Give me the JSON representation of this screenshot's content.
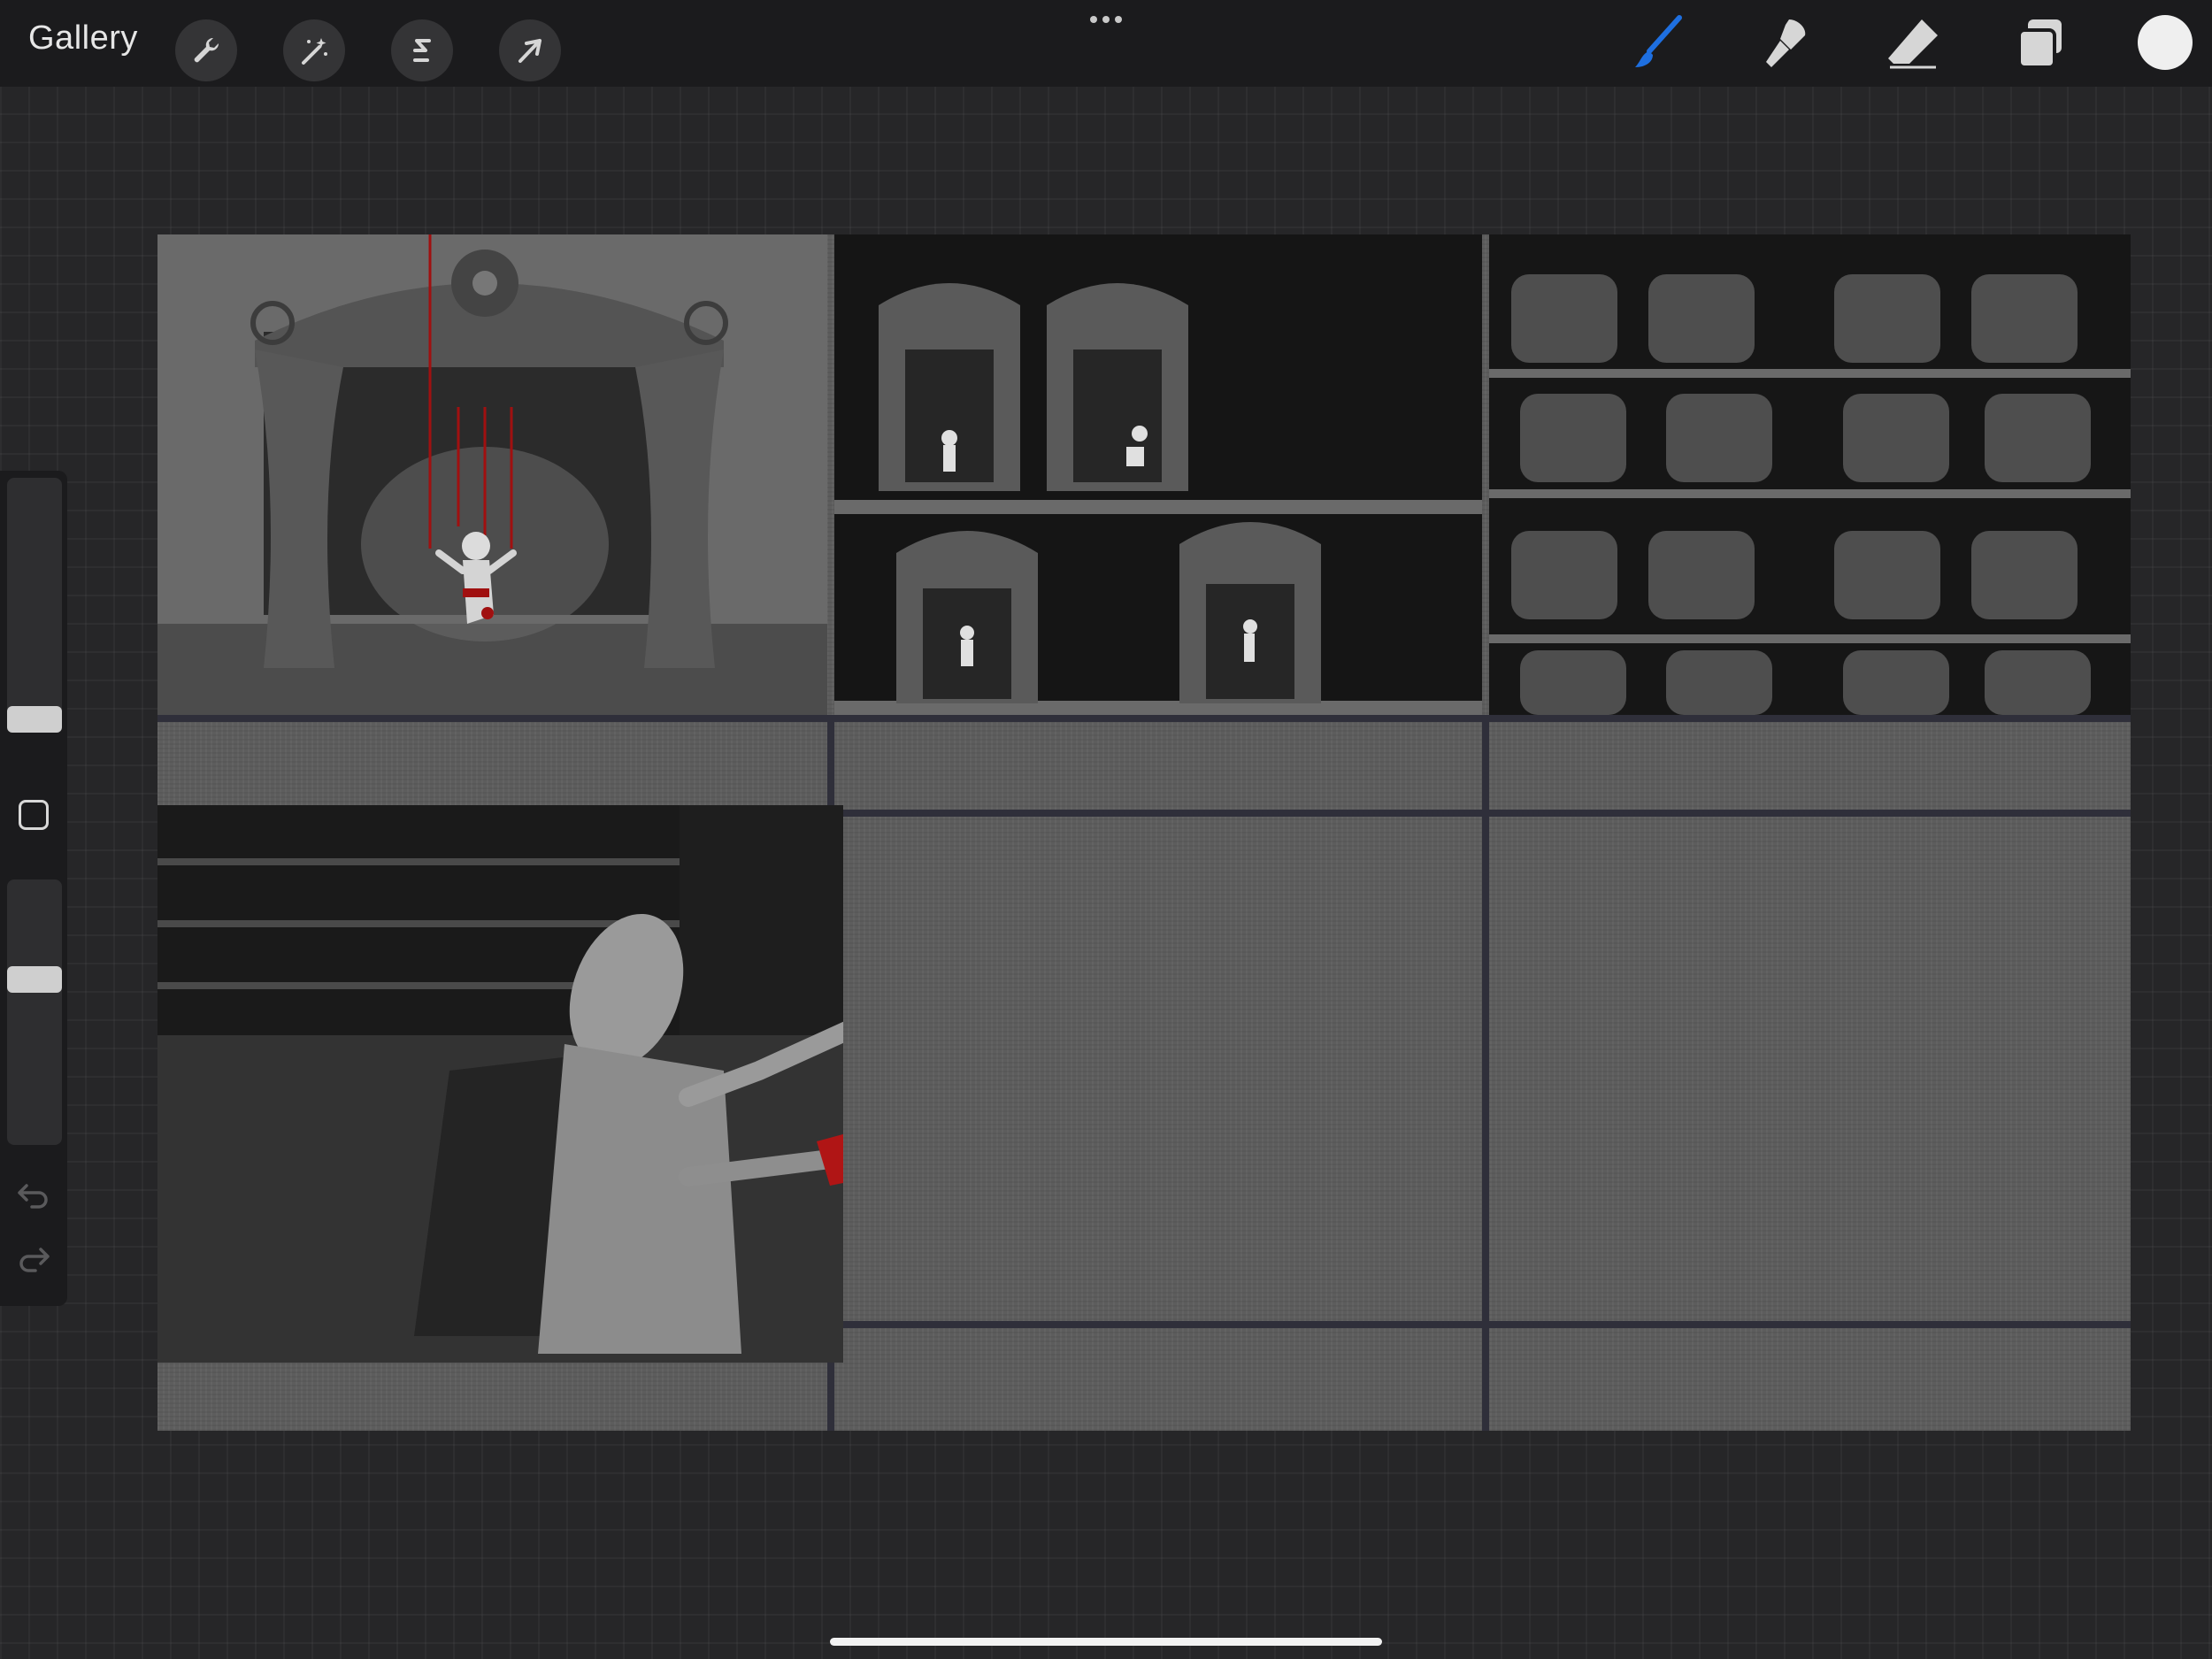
{
  "app": {
    "gallery_label": "Gallery"
  },
  "toolbar": {
    "left_tools": [
      "wrench-icon",
      "magic-wand-icon",
      "selection-s-icon",
      "transform-arrow-icon"
    ],
    "right_tools": [
      "brush-icon",
      "smudge-icon",
      "eraser-icon",
      "layers-icon"
    ],
    "active_tool": "brush-icon",
    "active_color": "#1e6fe0",
    "current_color": "#efefef"
  },
  "sidebar": {
    "brush_size_level": 0.33,
    "opacity_level": 0.3,
    "buttons": [
      "modify-square-icon",
      "undo-icon",
      "redo-icon"
    ]
  },
  "canvas": {
    "layout": "storyboard-grid",
    "columns": 3,
    "rows": 2,
    "panels": [
      {
        "name": "panel-single-puppet-theater",
        "filled": true
      },
      {
        "name": "panel-four-puppet-theaters",
        "filled": true
      },
      {
        "name": "panel-many-theaters-grid",
        "filled": true
      },
      {
        "name": "panel-puppeteer-at-desk",
        "filled": true
      },
      {
        "name": "panel-empty-5",
        "filled": false
      },
      {
        "name": "panel-empty-6",
        "filled": false
      }
    ]
  }
}
